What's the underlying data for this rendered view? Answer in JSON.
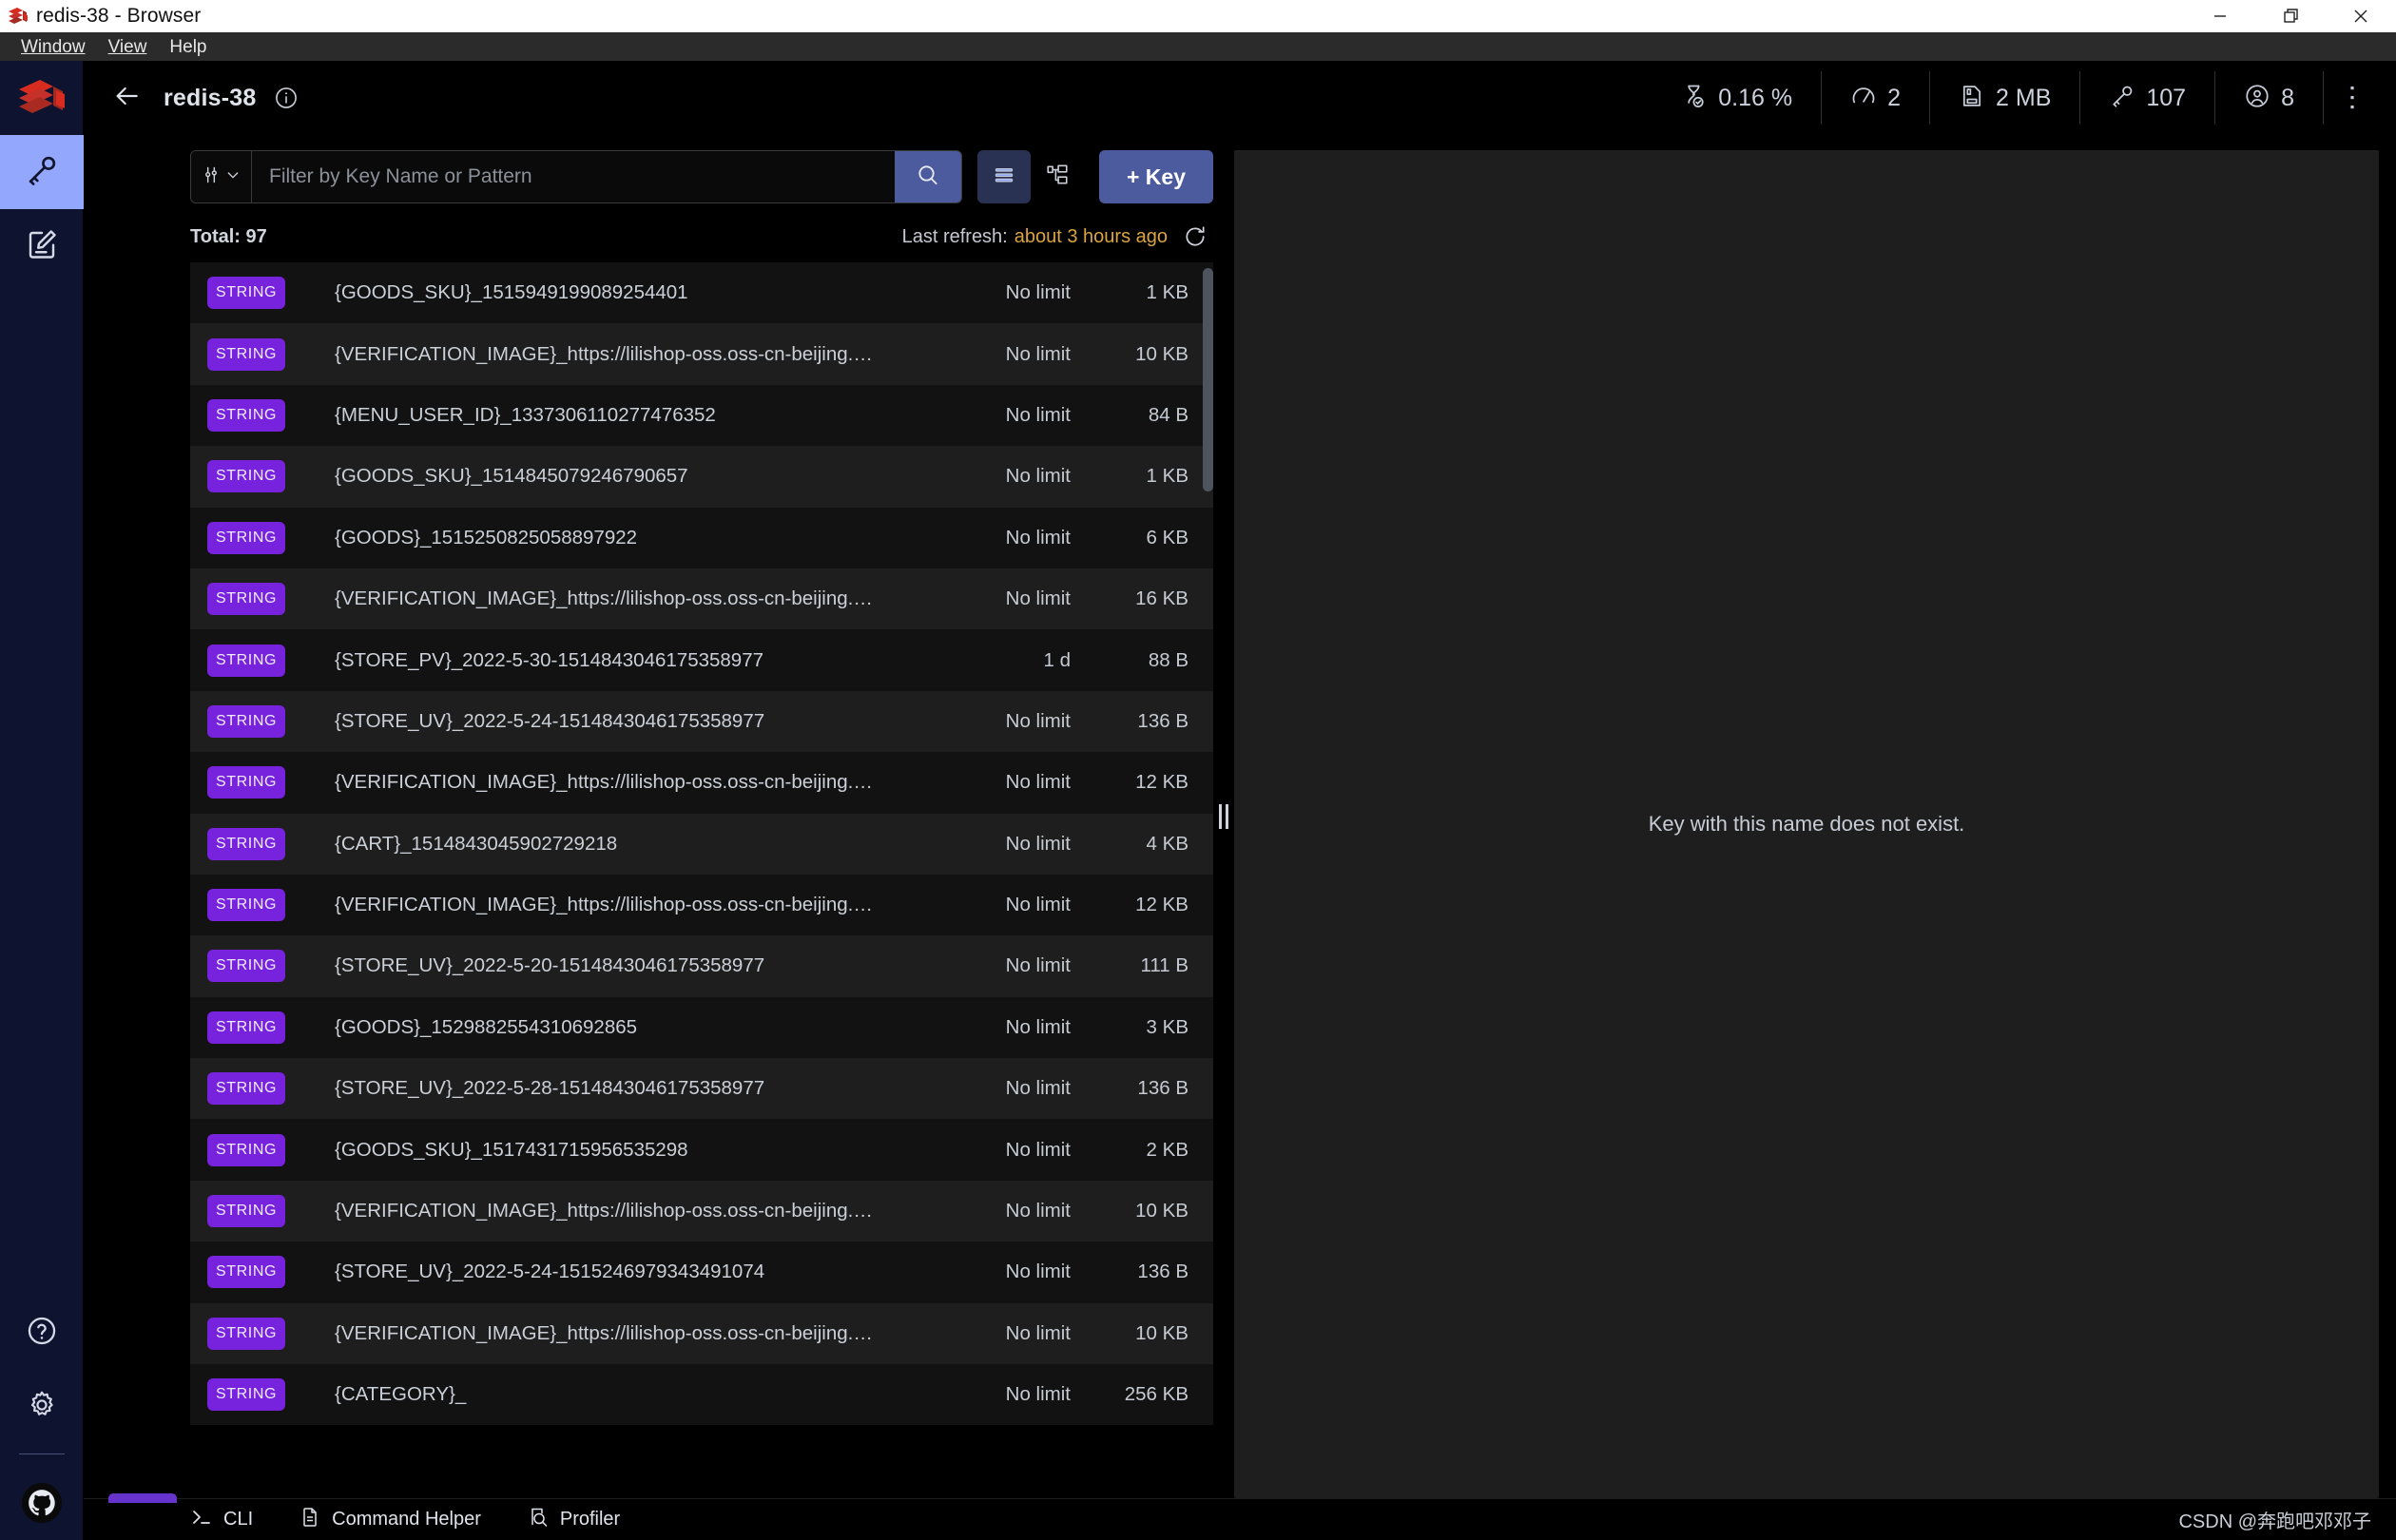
{
  "window": {
    "title": "redis-38 - Browser",
    "app_icon": "redis-logo-icon",
    "controls": {
      "minimize": "minimize-icon",
      "restore": "restore-icon",
      "close": "close-icon"
    }
  },
  "menubar": {
    "items": [
      {
        "label": "Window",
        "mnemonic": "W"
      },
      {
        "label": "View",
        "mnemonic": "V"
      },
      {
        "label": "Help",
        "mnemonic": "H"
      }
    ]
  },
  "rail": {
    "logo": "redis-logo-icon",
    "items": [
      {
        "name": "browser",
        "icon": "key-icon",
        "active": true
      },
      {
        "name": "workbench",
        "icon": "edit-document-icon",
        "active": false
      }
    ],
    "bottom": [
      {
        "name": "help",
        "icon": "question-circle-icon"
      },
      {
        "name": "settings",
        "icon": "gear-icon"
      },
      {
        "name": "github",
        "icon": "github-icon"
      }
    ]
  },
  "header": {
    "back_icon": "arrow-left-icon",
    "instance_name": "redis-38",
    "info_icon": "info-circle-icon",
    "stats": [
      {
        "name": "cpu",
        "icon": "hourglass-icon",
        "value": "0.16 %"
      },
      {
        "name": "commands-per-sec",
        "icon": "gauge-icon",
        "value": "2"
      },
      {
        "name": "memory",
        "icon": "memory-card-icon",
        "value": "2 MB"
      },
      {
        "name": "keys",
        "icon": "key-icon",
        "value": "107"
      },
      {
        "name": "clients",
        "icon": "user-circle-icon",
        "value": "8"
      }
    ],
    "overflow_icon": "kebab-menu-icon"
  },
  "toolbar": {
    "filter_icon": "sliders-icon",
    "chevron_icon": "chevron-down-icon",
    "search_placeholder": "Filter by Key Name or Pattern",
    "search_value": "",
    "search_icon": "search-icon",
    "list_view_icon": "list-view-icon",
    "tree_view_icon": "tree-view-icon",
    "add_key_label": "+ Key"
  },
  "subbar": {
    "total_label": "Total: 97",
    "refresh_label": "Last refresh:",
    "refresh_time": "about 3 hours ago",
    "refresh_icon": "refresh-icon"
  },
  "key_list": {
    "columns": [
      "type",
      "name",
      "ttl",
      "size"
    ],
    "rows": [
      {
        "type": "STRING",
        "name": "{GOODS_SKU}_1515949199089254401",
        "ttl": "No limit",
        "size": "1 KB"
      },
      {
        "type": "STRING",
        "name": "{VERIFICATION_IMAGE}_https://lilishop-oss.oss-cn-beijing.aliyuncs.co...",
        "ttl": "No limit",
        "size": "10 KB"
      },
      {
        "type": "STRING",
        "name": "{MENU_USER_ID}_1337306110277476352",
        "ttl": "No limit",
        "size": "84 B"
      },
      {
        "type": "STRING",
        "name": "{GOODS_SKU}_1514845079246790657",
        "ttl": "No limit",
        "size": "1 KB"
      },
      {
        "type": "STRING",
        "name": "{GOODS}_1515250825058897922",
        "ttl": "No limit",
        "size": "6 KB"
      },
      {
        "type": "STRING",
        "name": "{VERIFICATION_IMAGE}_https://lilishop-oss.oss-cn-beijing.aliyuncs.co...",
        "ttl": "No limit",
        "size": "16 KB"
      },
      {
        "type": "STRING",
        "name": "{STORE_PV}_2022-5-30-1514843046175358977",
        "ttl": "1 d",
        "size": "88 B"
      },
      {
        "type": "STRING",
        "name": "{STORE_UV}_2022-5-24-1514843046175358977",
        "ttl": "No limit",
        "size": "136 B"
      },
      {
        "type": "STRING",
        "name": "{VERIFICATION_IMAGE}_https://lilishop-oss.oss-cn-beijing.aliyuncs.co...",
        "ttl": "No limit",
        "size": "12 KB"
      },
      {
        "type": "STRING",
        "name": "{CART}_1514843045902729218",
        "ttl": "No limit",
        "size": "4 KB"
      },
      {
        "type": "STRING",
        "name": "{VERIFICATION_IMAGE}_https://lilishop-oss.oss-cn-beijing.aliyuncs.co...",
        "ttl": "No limit",
        "size": "12 KB"
      },
      {
        "type": "STRING",
        "name": "{STORE_UV}_2022-5-20-1514843046175358977",
        "ttl": "No limit",
        "size": "111 B"
      },
      {
        "type": "STRING",
        "name": "{GOODS}_1529882554310692865",
        "ttl": "No limit",
        "size": "3 KB"
      },
      {
        "type": "STRING",
        "name": "{STORE_UV}_2022-5-28-1514843046175358977",
        "ttl": "No limit",
        "size": "136 B"
      },
      {
        "type": "STRING",
        "name": "{GOODS_SKU}_1517431715956535298",
        "ttl": "No limit",
        "size": "2 KB"
      },
      {
        "type": "STRING",
        "name": "{VERIFICATION_IMAGE}_https://lilishop-oss.oss-cn-beijing.aliyuncs.co...",
        "ttl": "No limit",
        "size": "10 KB"
      },
      {
        "type": "STRING",
        "name": "{STORE_UV}_2022-5-24-1515246979343491074",
        "ttl": "No limit",
        "size": "136 B"
      },
      {
        "type": "STRING",
        "name": "{VERIFICATION_IMAGE}_https://lilishop-oss.oss-cn-beijing.aliyuncs.co...",
        "ttl": "No limit",
        "size": "10 KB"
      },
      {
        "type": "STRING",
        "name": "{CATEGORY}_",
        "ttl": "No limit",
        "size": "256 KB"
      }
    ]
  },
  "details_panel": {
    "empty_message": "Key with this name does not exist."
  },
  "bottom_bar": {
    "items": [
      {
        "name": "cli",
        "label": "CLI",
        "icon": "terminal-prompt-icon"
      },
      {
        "name": "command-helper",
        "label": "Command Helper",
        "icon": "document-icon"
      },
      {
        "name": "profiler",
        "label": "Profiler",
        "icon": "magnifier-document-icon"
      }
    ],
    "watermark": "CSDN @奔跑吧邓邓子"
  },
  "colors": {
    "accent_purple": "#7722dd",
    "button_blue": "#4c5b9e",
    "rail_navy": "#0e1430",
    "rail_active": "#93a7fc",
    "refresh_orange": "#d9a441",
    "redis_red": "#d82c20"
  }
}
